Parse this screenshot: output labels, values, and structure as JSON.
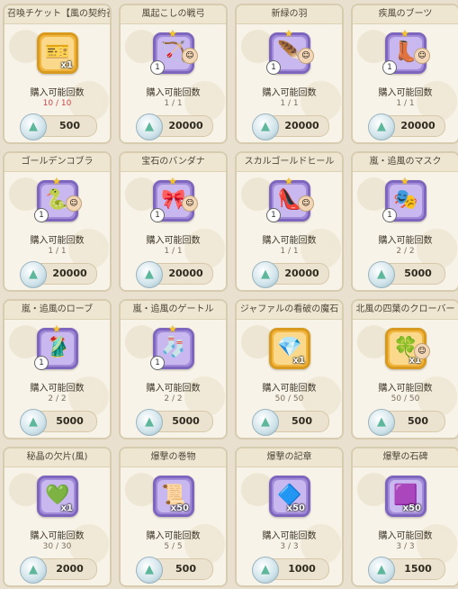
{
  "shop": {
    "purchasable_label": "購入可能回数",
    "items": [
      {
        "name": "召喚チケット【風の契約召喚】",
        "icon": "ticket-icon",
        "glyph": "🎫",
        "frame": "gold",
        "qty": "x1",
        "level": "",
        "star": false,
        "portrait": false,
        "count": "10 / 10",
        "count_red": true,
        "price": "500"
      },
      {
        "name": "風起こしの戦弓",
        "icon": "bow-icon",
        "glyph": "🏹",
        "frame": "purple",
        "qty": "",
        "level": "1",
        "star": true,
        "portrait": true,
        "count": "1 / 1",
        "count_red": false,
        "price": "20000"
      },
      {
        "name": "新緑の羽",
        "icon": "feather-icon",
        "glyph": "🪶",
        "frame": "purple",
        "qty": "",
        "level": "1",
        "star": true,
        "portrait": true,
        "count": "1 / 1",
        "count_red": false,
        "price": "20000"
      },
      {
        "name": "疾風のブーツ",
        "icon": "boots-icon",
        "glyph": "👢",
        "frame": "purple",
        "qty": "",
        "level": "1",
        "star": true,
        "portrait": true,
        "count": "1 / 1",
        "count_red": false,
        "price": "20000"
      },
      {
        "name": "ゴールデンコブラ",
        "icon": "cobra-icon",
        "glyph": "🐍",
        "frame": "purple",
        "qty": "",
        "level": "1",
        "star": true,
        "portrait": true,
        "count": "1 / 1",
        "count_red": false,
        "price": "20000"
      },
      {
        "name": "宝石のバンダナ",
        "icon": "bandana-icon",
        "glyph": "🎀",
        "frame": "purple",
        "qty": "",
        "level": "1",
        "star": true,
        "portrait": true,
        "count": "1 / 1",
        "count_red": false,
        "price": "20000"
      },
      {
        "name": "スカルゴールドヒール",
        "icon": "heel-icon",
        "glyph": "👠",
        "frame": "purple",
        "qty": "",
        "level": "1",
        "star": true,
        "portrait": true,
        "count": "1 / 1",
        "count_red": false,
        "price": "20000"
      },
      {
        "name": "嵐・追風のマスク",
        "icon": "mask-icon",
        "glyph": "🎭",
        "frame": "purple",
        "qty": "",
        "level": "1",
        "star": true,
        "portrait": false,
        "count": "2 / 2",
        "count_red": false,
        "price": "5000"
      },
      {
        "name": "嵐・追風のローブ",
        "icon": "robe-icon",
        "glyph": "🥻",
        "frame": "purple",
        "qty": "",
        "level": "1",
        "star": true,
        "portrait": false,
        "count": "2 / 2",
        "count_red": false,
        "price": "5000"
      },
      {
        "name": "嵐・追風のゲートル",
        "icon": "gaiter-icon",
        "glyph": "🧦",
        "frame": "purple",
        "qty": "",
        "level": "1",
        "star": true,
        "portrait": false,
        "count": "2 / 2",
        "count_red": false,
        "price": "5000"
      },
      {
        "name": "ジャファルの看破の魔石",
        "icon": "gem-icon",
        "glyph": "💎",
        "frame": "gold",
        "qty": "x1",
        "level": "",
        "star": false,
        "portrait": false,
        "count": "50 / 50",
        "count_red": false,
        "price": "500"
      },
      {
        "name": "北風の四葉のクローバー",
        "icon": "clover-icon",
        "glyph": "🍀",
        "frame": "gold",
        "qty": "x1",
        "level": "",
        "star": false,
        "portrait": true,
        "count": "50 / 50",
        "count_red": false,
        "price": "500"
      },
      {
        "name": "秘晶の欠片(風)",
        "icon": "crystal-shard-icon",
        "glyph": "💚",
        "frame": "purple",
        "qty": "x1",
        "level": "",
        "star": false,
        "portrait": false,
        "count": "30 / 30",
        "count_red": false,
        "price": "2000"
      },
      {
        "name": "爆撃の巻物",
        "icon": "scroll-icon",
        "glyph": "📜",
        "frame": "purple",
        "qty": "x50",
        "level": "",
        "star": false,
        "portrait": false,
        "count": "5 / 5",
        "count_red": false,
        "price": "500"
      },
      {
        "name": "爆撃の記章",
        "icon": "badge-icon",
        "glyph": "🔷",
        "frame": "purple",
        "qty": "x50",
        "level": "",
        "star": false,
        "portrait": false,
        "count": "3 / 3",
        "count_red": false,
        "price": "1000"
      },
      {
        "name": "爆撃の石碑",
        "icon": "stone-tablet-icon",
        "glyph": "🟪",
        "frame": "purple",
        "qty": "x50",
        "level": "",
        "star": false,
        "portrait": false,
        "count": "3 / 3",
        "count_red": false,
        "price": "1500"
      }
    ]
  },
  "colors": {
    "background": "#e9e0cf",
    "card": "#f8f3e8",
    "gold_frame": "#f2b53e",
    "purple_frame": "#a18bd8",
    "count_red": "#c74848"
  }
}
